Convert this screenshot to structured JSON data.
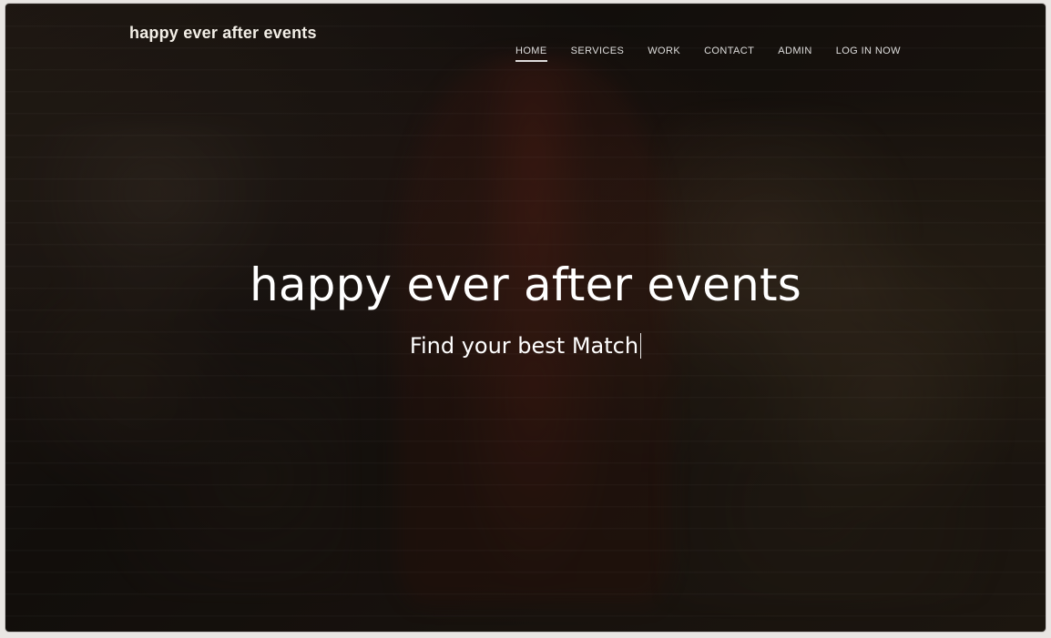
{
  "header": {
    "brand": "happy ever after events",
    "nav": [
      {
        "label": "HOME",
        "active": true
      },
      {
        "label": "SERVICES",
        "active": false
      },
      {
        "label": "WORK",
        "active": false
      },
      {
        "label": "CONTACT",
        "active": false
      },
      {
        "label": "ADMIN",
        "active": false
      },
      {
        "label": "LOG IN NOW",
        "active": false
      }
    ]
  },
  "hero": {
    "title": "happy ever after events",
    "subtitle": "Find your best Match"
  }
}
